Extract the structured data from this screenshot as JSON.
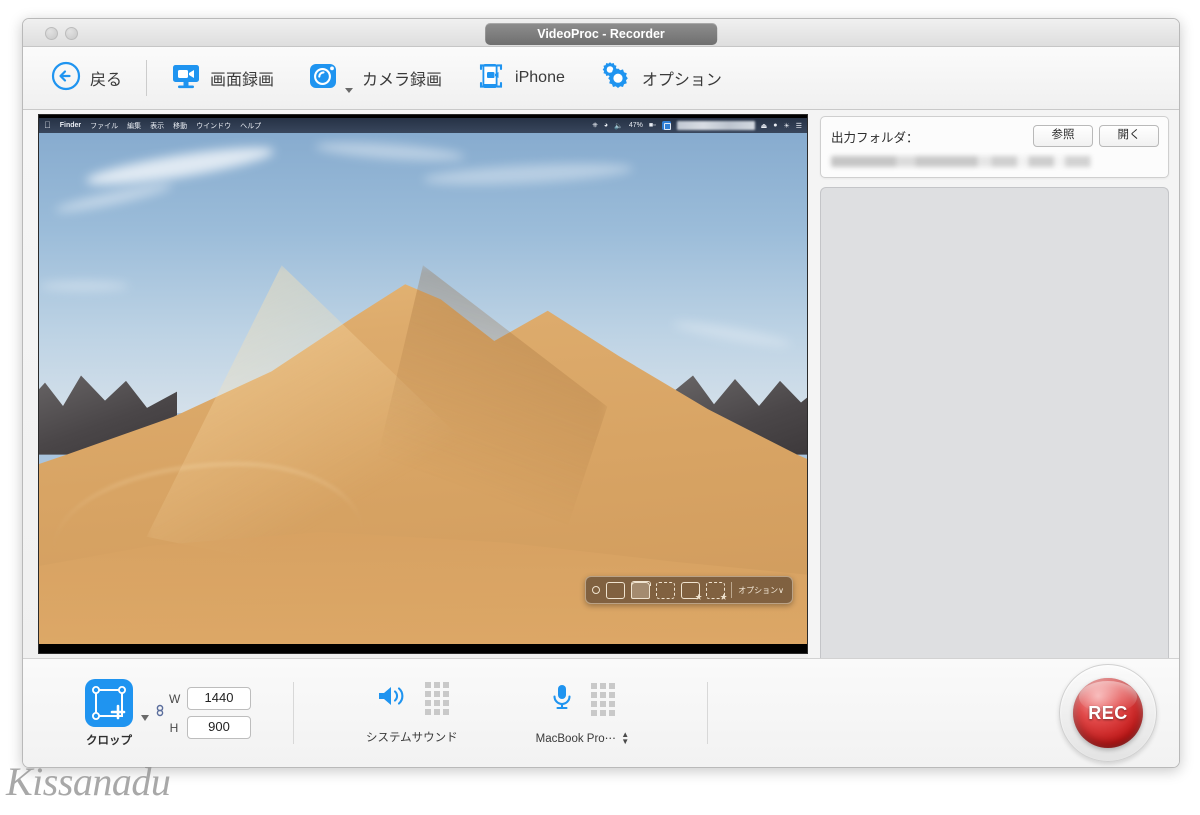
{
  "window": {
    "title": "VideoProc - Recorder",
    "traffic_lights": [
      "close",
      "minimize"
    ]
  },
  "toolbar": {
    "back_label": "戻る",
    "items": [
      {
        "icon": "screen-record-icon",
        "label": "画面録画",
        "has_caret": false
      },
      {
        "icon": "camera-record-icon",
        "label": "カメラ録画",
        "has_caret": true
      },
      {
        "icon": "iphone-icon",
        "label": "iPhone",
        "has_caret": false
      },
      {
        "icon": "gear-options-icon",
        "label": "オプション",
        "has_caret": false
      }
    ]
  },
  "preview": {
    "menubar": {
      "apple": "",
      "items": [
        "Finder",
        "ファイル",
        "編集",
        "表示",
        "移動",
        "ウインドウ",
        "ヘルプ"
      ],
      "status": {
        "battery_percent": "47%",
        "icons": [
          "airdrop-icon",
          "wifi-icon",
          "volume-icon",
          "battery-icon",
          "app-icon",
          "blurred-field",
          "display-icon",
          "dot-icon",
          "globe-icon",
          "list-icon"
        ]
      }
    },
    "shot_toolbar": {
      "modes": [
        "capture-entire-screen",
        "capture-selected-window",
        "capture-selected-portion",
        "record-entire-screen",
        "record-selected-portion"
      ],
      "options_label": "オプション∨"
    }
  },
  "right_panel": {
    "output_folder_label": "出力フォルダ：",
    "browse_label": "参照",
    "open_label": "開く",
    "output_path": "",
    "file_list": []
  },
  "bottom_bar": {
    "crop": {
      "label": "クロップ",
      "icon": "crop-icon",
      "width_key": "W",
      "width_value": "1440",
      "height_key": "H",
      "height_value": "900",
      "link_icon": "link-chain-icon"
    },
    "system_sound": {
      "icon": "speaker-icon",
      "label": "システムサウンド"
    },
    "microphone": {
      "icon": "microphone-icon",
      "label": "MacBook Pro⋯",
      "stepper": "⌃⌄"
    },
    "record_button_label": "REC"
  },
  "watermark": {
    "text": "Kissanadu"
  },
  "colors": {
    "accent_blue": "#1f94f0",
    "rec_red": "#c01717",
    "title_tab": "#7e7e7e"
  }
}
